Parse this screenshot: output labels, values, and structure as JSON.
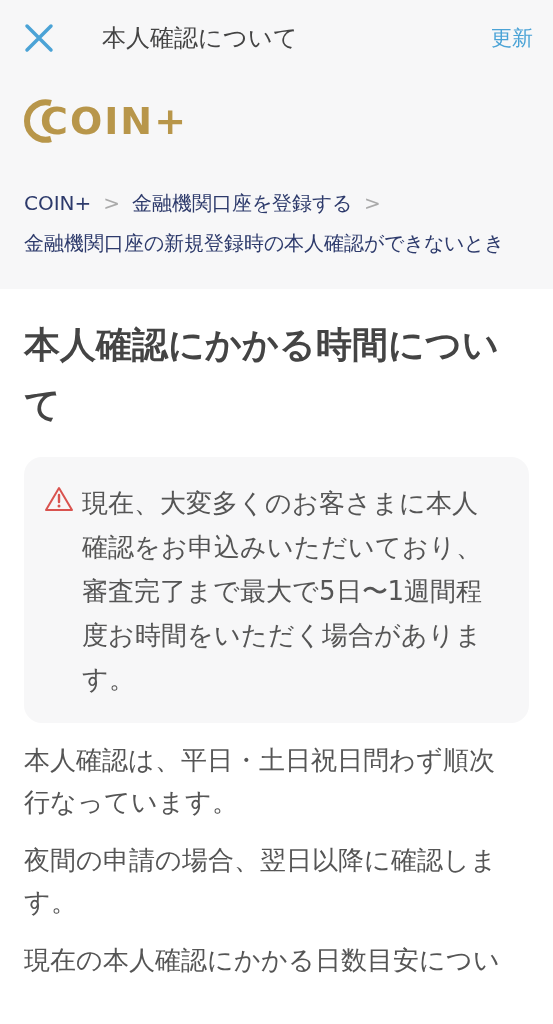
{
  "header": {
    "title": "本人確認について",
    "action": "更新"
  },
  "logo": {
    "text": "COIN+"
  },
  "breadcrumb": [
    {
      "label": "COIN+"
    },
    {
      "label": "金融機関口座を登録する"
    },
    {
      "label": "金融機関口座の新規登録時の本人確認ができないとき"
    }
  ],
  "breadcrumb_separator": ">",
  "heading": "本人確認にかかる時間について",
  "notice": {
    "text": "現在、大変多くのお客さまに本人確認をお申込みいただいており、審査完了まで最大で5日〜1週間程度お時間をいただく場合があります。"
  },
  "paragraphs": [
    "本人確認は、平日・土日祝日問わず順次行なっています。",
    "夜間の申請の場合、翌日以降に確認します。",
    "現在の本人確認にかかる日数目安につい"
  ]
}
